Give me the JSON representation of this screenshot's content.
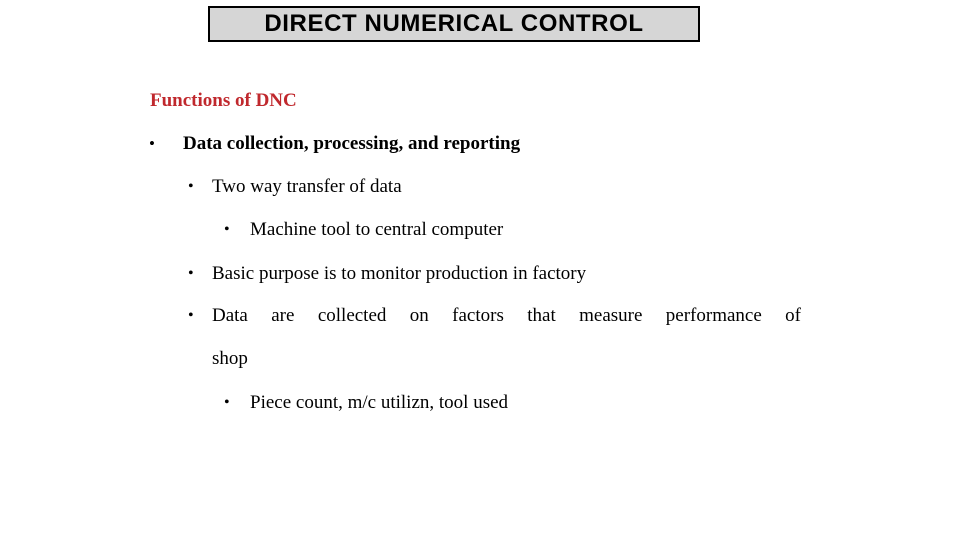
{
  "slide": {
    "background_color": "#ffffff",
    "title": {
      "text": "DIRECT NUMERICAL CONTROL",
      "fill_color": "#d6d6d6",
      "border_color": "#000000",
      "text_color": "#000000"
    },
    "heading": {
      "text": "Functions of DNC",
      "color": "#C0282D"
    },
    "bullets": [
      {
        "level": 1,
        "marker": "•",
        "text": "Data collection, processing, and reporting",
        "bold": true
      },
      {
        "level": 2,
        "marker": "•",
        "text": "Two way transfer of data",
        "bold": false
      },
      {
        "level": 3,
        "marker": "•",
        "text": "Machine tool to central computer",
        "bold": false
      },
      {
        "level": 2,
        "marker": "•",
        "text": "Basic purpose is to monitor production in factory",
        "bold": false
      },
      {
        "level": 2,
        "marker": "•",
        "text_line1": "Data are collected on factors that measure performance of",
        "text_line2": "shop",
        "bold": false,
        "justified": true
      },
      {
        "level": 3,
        "marker": "•",
        "text": "Piece count,  m/c utilizn, tool used",
        "bold": false
      }
    ]
  }
}
